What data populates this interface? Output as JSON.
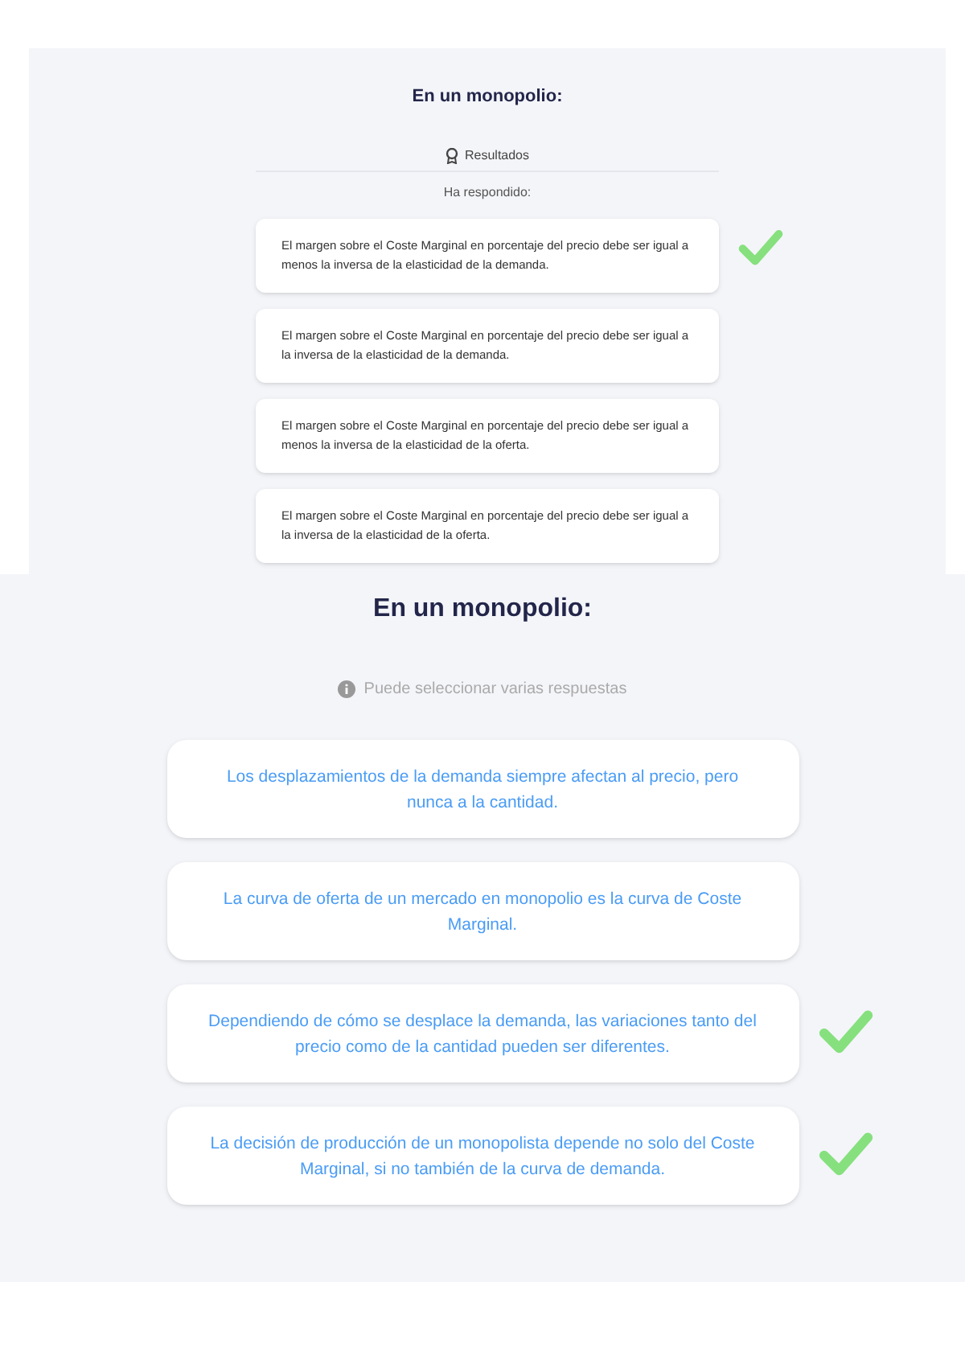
{
  "results_panel": {
    "title": "En un monopolio:",
    "results_label": "Resultados",
    "answered_label": "Ha respondido:",
    "answers": [
      {
        "text": "El margen sobre el Coste Marginal en porcentaje del precio debe ser igual a menos la inversa de la elasticidad de la demanda.",
        "checked": true
      },
      {
        "text": "El margen sobre el Coste Marginal en porcentaje del precio debe ser igual a la inversa de la elasticidad de la demanda.",
        "checked": false
      },
      {
        "text": "El margen sobre el Coste Marginal en porcentaje del precio debe ser igual a menos la inversa de la elasticidad de la oferta.",
        "checked": false
      },
      {
        "text": "El margen sobre el Coste Marginal en porcentaje del precio debe ser igual a la inversa de la elasticidad de la oferta.",
        "checked": false
      }
    ]
  },
  "question_panel": {
    "title": "En un monopolio:",
    "hint": "Puede seleccionar varias respuestas",
    "options": [
      {
        "text": "Los desplazamientos de la demanda siempre afectan al precio, pero nunca a la cantidad.",
        "checked": false
      },
      {
        "text": "La curva de oferta de un mercado en monopolio es la curva de Coste Marginal.",
        "checked": false
      },
      {
        "text": "Dependiendo de cómo se desplace la demanda, las variaciones tanto del precio como de la cantidad pueden ser diferentes.",
        "checked": true
      },
      {
        "text": "La decisión de producción de un monopolista depende no solo del Coste Marginal, si no también de la curva de demanda.",
        "checked": true
      }
    ]
  }
}
